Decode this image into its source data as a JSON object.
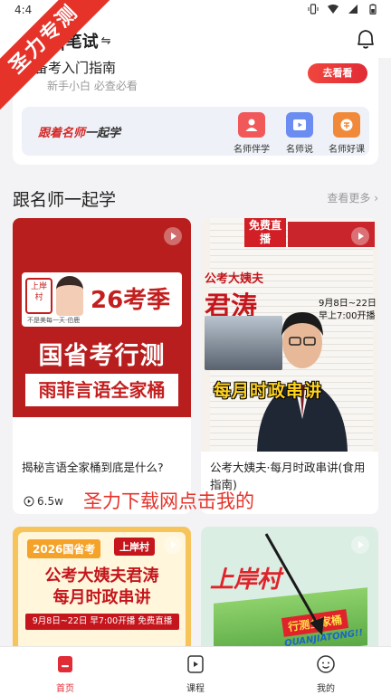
{
  "status_bar": {
    "time": "4:4"
  },
  "watermark": {
    "ribbon": "圣力专测",
    "overlay": "圣力下载网点击我的"
  },
  "header": {
    "exam_label": "国考|笔试",
    "exam_visible": "员|笔试",
    "switch_glyph": "⇋"
  },
  "guide": {
    "title": "备考入门指南",
    "title_visible": "备考入门指南",
    "subtitle": "新手小白 必查必看",
    "button": "去看看"
  },
  "teacher_panel": {
    "slogan_red": "跟着名师",
    "slogan_dark": "一起学",
    "items": [
      {
        "label": "名师伴学",
        "icon": "person-icon",
        "color": "#f0585a"
      },
      {
        "label": "名师说",
        "icon": "play-icon",
        "color": "#6b8cf0"
      },
      {
        "label": "名师好课",
        "icon": "course-icon",
        "color": "#f08a3a"
      }
    ]
  },
  "section": {
    "title": "跟名师一起学",
    "more": "查看更多 ›"
  },
  "cards": [
    {
      "title": "揭秘言语全家桶到底是什么?",
      "views": "6.5w",
      "thumb": {
        "badge": "上岸村",
        "season": "26考季",
        "slogan": "不是美每一天·伯鹿",
        "main": "国省考行测",
        "sub": "雨菲言语全家桶"
      }
    },
    {
      "title": "公考大姨夫·每月时政串讲(食用指南)",
      "views": "",
      "thumb": {
        "live": "免费直播",
        "aunt": "公考大姨夫",
        "name": "君涛",
        "date_line1": "9月8日~22日",
        "date_line2": "早上7:00开播",
        "banner": "每月时政串讲"
      }
    },
    {
      "title": "",
      "thumb": {
        "year": "2026国省考",
        "logo": "上岸村",
        "line1": "公考大姨夫君涛",
        "line2": "每月时政串讲",
        "date": "9月8日~22日 早7:00开播 免费直播"
      }
    },
    {
      "title": "",
      "thumb": {
        "title": "上岸村",
        "box_label": "行测全家桶",
        "brand": "QUANJIATONG!!"
      }
    }
  ],
  "bottom_nav": [
    {
      "label": "首页",
      "active": true
    },
    {
      "label": "课程",
      "active": false
    },
    {
      "label": "我的",
      "active": false
    }
  ],
  "colors": {
    "accent": "#e12b35",
    "nav_inactive": "#333333"
  }
}
